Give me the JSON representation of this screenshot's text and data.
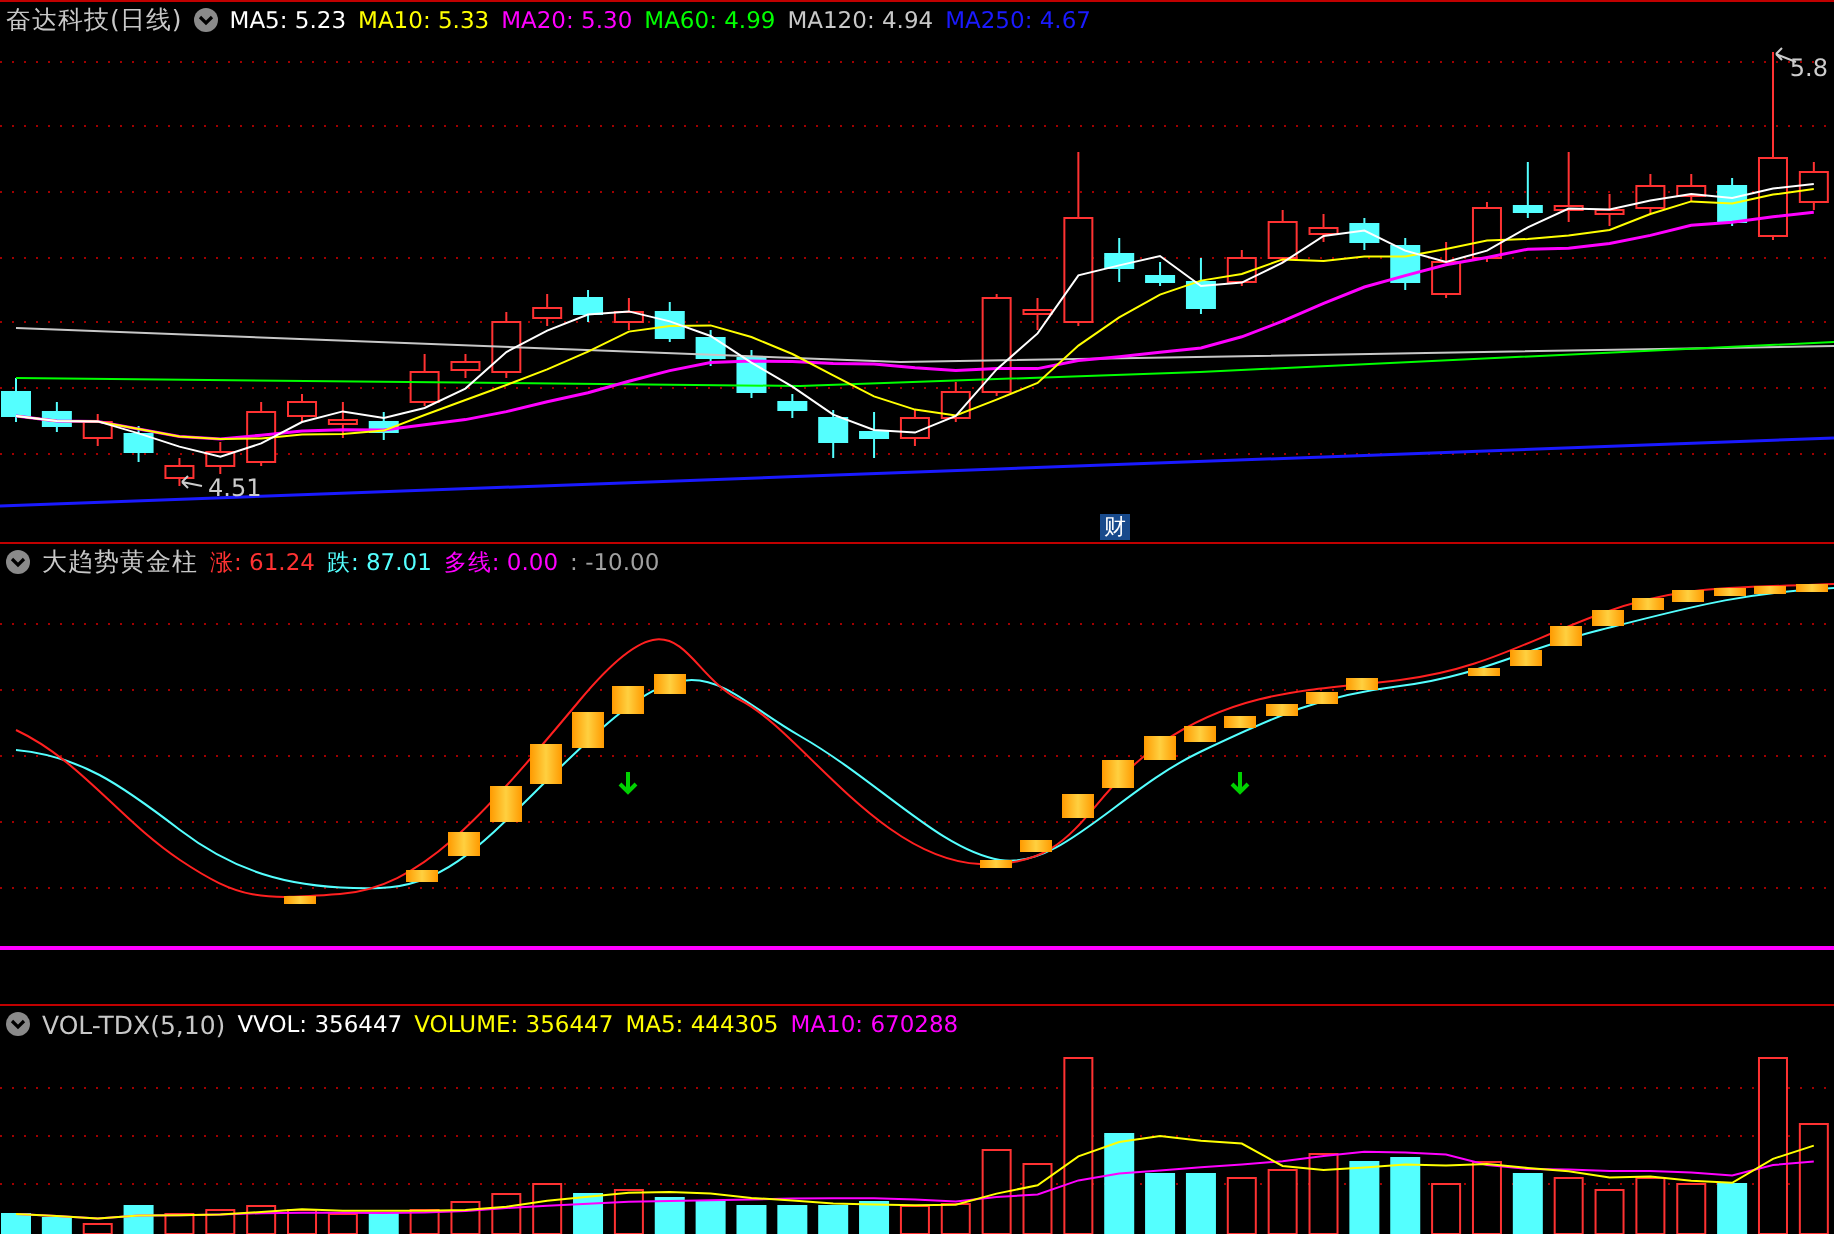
{
  "main_panel": {
    "title": "奋达科技(日线)",
    "indicators": [
      {
        "label": "MA5: 5.23",
        "color": "#ffffff"
      },
      {
        "label": "MA10: 5.33",
        "color": "#ffff00"
      },
      {
        "label": "MA20: 5.30",
        "color": "#ff00ff"
      },
      {
        "label": "MA60: 4.99",
        "color": "#00ff00"
      },
      {
        "label": "MA120: 4.94",
        "color": "#c8c8c8"
      },
      {
        "label": "MA250: 4.67",
        "color": "#1a1aff"
      }
    ],
    "high_label": "5.8",
    "low_label": "4.51",
    "marker": "财"
  },
  "indicator_panel": {
    "title": "大趋势黄金柱",
    "values": [
      {
        "label": "涨: 61.24",
        "color": "#ff3232"
      },
      {
        "label": "跌: 87.01",
        "color": "#54ffff"
      },
      {
        "label": "多线: 0.00",
        "color": "#ff00ff"
      },
      {
        "label": ": -10.00",
        "color": "#a0a0a0"
      }
    ]
  },
  "volume_panel": {
    "title": "VOL-TDX(5,10)",
    "values": [
      {
        "label": "VVOL: 356447",
        "color": "#ffffff"
      },
      {
        "label": "VOLUME: 356447",
        "color": "#ffff00"
      },
      {
        "label": "MA5: 444305",
        "color": "#ffff00"
      },
      {
        "label": "MA10: 670288",
        "color": "#ff00ff"
      }
    ]
  }
}
